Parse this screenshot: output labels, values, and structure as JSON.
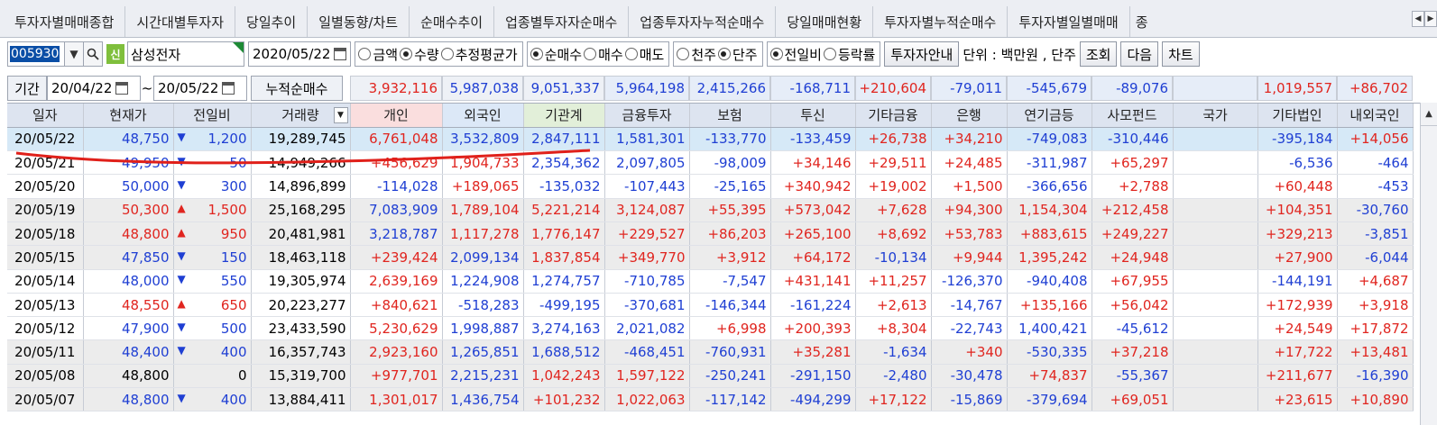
{
  "tabs": [
    "투자자별매매종합",
    "시간대별투자자",
    "당일추이",
    "일별동향/차트",
    "순매수추이",
    "업종별투자자순매수",
    "업종투자자누적순매수",
    "당일매매현황",
    "투자자별누적순매수",
    "투자자별일별매매",
    "종"
  ],
  "toolbar": {
    "code": "005930",
    "shin": "신",
    "stock_name": "삼성전자",
    "date": "2020/05/22",
    "radio1": [
      "금액",
      "수량",
      "추정평균가"
    ],
    "radio1_selected": "수량",
    "radio2": [
      "순매수",
      "매수",
      "매도"
    ],
    "radio2_selected": "순매수",
    "radio3": [
      "천주",
      "단주"
    ],
    "radio3_selected": "단주",
    "radio4": [
      "전일비",
      "등락률"
    ],
    "radio4_selected": "전일비",
    "investor_btn": "투자자안내",
    "unit": "단위 : 백만원 , 단주",
    "query_btn": "조회",
    "next_btn": "다음",
    "chart_btn": "차트"
  },
  "period": {
    "label": "기간",
    "from": "20/04/22",
    "tilde": "~",
    "to": "20/05/22",
    "cum_label": "누적순매수",
    "cum_values": [
      {
        "v": "3,932,116",
        "c": "red"
      },
      {
        "v": "5,987,038",
        "c": "blu"
      },
      {
        "v": "9,051,337",
        "c": "blu"
      },
      {
        "v": "5,964,198",
        "c": "blu"
      },
      {
        "v": "2,415,266",
        "c": "blu"
      },
      {
        "v": "-168,711",
        "c": "blu"
      },
      {
        "v": "+210,604",
        "c": "red"
      },
      {
        "v": "-79,011",
        "c": "blu"
      },
      {
        "v": "-545,679",
        "c": "blu"
      },
      {
        "v": "-89,076",
        "c": "blu"
      },
      {
        "v": "",
        "c": "blk"
      },
      {
        "v": "1,019,557",
        "c": "red"
      },
      {
        "v": "+86,702",
        "c": "red"
      }
    ]
  },
  "table": {
    "headers": [
      "일자",
      "현재가",
      "전일비",
      "거래량",
      "개인",
      "외국인",
      "기관계",
      "금융투자",
      "보험",
      "투신",
      "기타금융",
      "은행",
      "연기금등",
      "사모펀드",
      "국가",
      "기타법인",
      "내외국인"
    ],
    "rows": [
      {
        "date": "20/05/22",
        "price": "48,750",
        "pc": "blu",
        "dir": "down",
        "diff": "1,200",
        "vol": "19,289,745",
        "cells": [
          [
            "6,761,048",
            "red"
          ],
          [
            "3,532,809",
            "blu"
          ],
          [
            "2,847,111",
            "blu"
          ],
          [
            "1,581,301",
            "blu"
          ],
          [
            "-133,770",
            "blu"
          ],
          [
            "-133,459",
            "blu"
          ],
          [
            "+26,738",
            "red"
          ],
          [
            "+34,210",
            "red"
          ],
          [
            "-749,083",
            "blu"
          ],
          [
            "-310,446",
            "blu"
          ],
          [
            "",
            ""
          ],
          [
            "-395,184",
            "blu"
          ],
          [
            "+14,056",
            "red"
          ]
        ]
      },
      {
        "date": "20/05/21",
        "price": "49,950",
        "pc": "blu",
        "dir": "down",
        "diff": "50",
        "vol": "14,949,266",
        "cells": [
          [
            "+456,629",
            "red"
          ],
          [
            "1,904,733",
            "red"
          ],
          [
            "2,354,362",
            "blu"
          ],
          [
            "2,097,805",
            "blu"
          ],
          [
            "-98,009",
            "blu"
          ],
          [
            "+34,146",
            "red"
          ],
          [
            "+29,511",
            "red"
          ],
          [
            "+24,485",
            "red"
          ],
          [
            "-311,987",
            "blu"
          ],
          [
            "+65,297",
            "red"
          ],
          [
            "",
            ""
          ],
          [
            "-6,536",
            "blu"
          ],
          [
            "-464",
            "blu"
          ]
        ]
      },
      {
        "date": "20/05/20",
        "price": "50,000",
        "pc": "blu",
        "dir": "down",
        "diff": "300",
        "vol": "14,896,899",
        "cells": [
          [
            "-114,028",
            "blu"
          ],
          [
            "+189,065",
            "red"
          ],
          [
            "-135,032",
            "blu"
          ],
          [
            "-107,443",
            "blu"
          ],
          [
            "-25,165",
            "blu"
          ],
          [
            "+340,942",
            "red"
          ],
          [
            "+19,002",
            "red"
          ],
          [
            "+1,500",
            "red"
          ],
          [
            "-366,656",
            "blu"
          ],
          [
            "+2,788",
            "red"
          ],
          [
            "",
            ""
          ],
          [
            "+60,448",
            "red"
          ],
          [
            "-453",
            "blu"
          ]
        ]
      },
      {
        "date": "20/05/19",
        "price": "50,300",
        "pc": "red",
        "dir": "up",
        "diff": "1,500",
        "vol": "25,168,295",
        "cells": [
          [
            "7,083,909",
            "blu"
          ],
          [
            "1,789,104",
            "red"
          ],
          [
            "5,221,214",
            "red"
          ],
          [
            "3,124,087",
            "red"
          ],
          [
            "+55,395",
            "red"
          ],
          [
            "+573,042",
            "red"
          ],
          [
            "+7,628",
            "red"
          ],
          [
            "+94,300",
            "red"
          ],
          [
            "1,154,304",
            "red"
          ],
          [
            "+212,458",
            "red"
          ],
          [
            "",
            ""
          ],
          [
            "+104,351",
            "red"
          ],
          [
            "-30,760",
            "blu"
          ]
        ]
      },
      {
        "date": "20/05/18",
        "price": "48,800",
        "pc": "red",
        "dir": "up",
        "diff": "950",
        "vol": "20,481,981",
        "cells": [
          [
            "3,218,787",
            "blu"
          ],
          [
            "1,117,278",
            "red"
          ],
          [
            "1,776,147",
            "red"
          ],
          [
            "+229,527",
            "red"
          ],
          [
            "+86,203",
            "red"
          ],
          [
            "+265,100",
            "red"
          ],
          [
            "+8,692",
            "red"
          ],
          [
            "+53,783",
            "red"
          ],
          [
            "+883,615",
            "red"
          ],
          [
            "+249,227",
            "red"
          ],
          [
            "",
            ""
          ],
          [
            "+329,213",
            "red"
          ],
          [
            "-3,851",
            "blu"
          ]
        ]
      },
      {
        "date": "20/05/15",
        "price": "47,850",
        "pc": "blu",
        "dir": "down",
        "diff": "150",
        "vol": "18,463,118",
        "cells": [
          [
            "+239,424",
            "red"
          ],
          [
            "2,099,134",
            "blu"
          ],
          [
            "1,837,854",
            "red"
          ],
          [
            "+349,770",
            "red"
          ],
          [
            "+3,912",
            "red"
          ],
          [
            "+64,172",
            "red"
          ],
          [
            "-10,134",
            "blu"
          ],
          [
            "+9,944",
            "red"
          ],
          [
            "1,395,242",
            "red"
          ],
          [
            "+24,948",
            "red"
          ],
          [
            "",
            ""
          ],
          [
            "+27,900",
            "red"
          ],
          [
            "-6,044",
            "blu"
          ]
        ]
      },
      {
        "date": "20/05/14",
        "price": "48,000",
        "pc": "blu",
        "dir": "down",
        "diff": "550",
        "vol": "19,305,974",
        "cells": [
          [
            "2,639,169",
            "red"
          ],
          [
            "1,224,908",
            "blu"
          ],
          [
            "1,274,757",
            "blu"
          ],
          [
            "-710,785",
            "blu"
          ],
          [
            "-7,547",
            "blu"
          ],
          [
            "+431,141",
            "red"
          ],
          [
            "+11,257",
            "red"
          ],
          [
            "-126,370",
            "blu"
          ],
          [
            "-940,408",
            "blu"
          ],
          [
            "+67,955",
            "red"
          ],
          [
            "",
            ""
          ],
          [
            "-144,191",
            "blu"
          ],
          [
            "+4,687",
            "red"
          ]
        ]
      },
      {
        "date": "20/05/13",
        "price": "48,550",
        "pc": "red",
        "dir": "up",
        "diff": "650",
        "vol": "20,223,277",
        "cells": [
          [
            "+840,621",
            "red"
          ],
          [
            "-518,283",
            "blu"
          ],
          [
            "-499,195",
            "blu"
          ],
          [
            "-370,681",
            "blu"
          ],
          [
            "-146,344",
            "blu"
          ],
          [
            "-161,224",
            "blu"
          ],
          [
            "+2,613",
            "red"
          ],
          [
            "-14,767",
            "blu"
          ],
          [
            "+135,166",
            "red"
          ],
          [
            "+56,042",
            "red"
          ],
          [
            "",
            ""
          ],
          [
            "+172,939",
            "red"
          ],
          [
            "+3,918",
            "red"
          ]
        ]
      },
      {
        "date": "20/05/12",
        "price": "47,900",
        "pc": "blu",
        "dir": "down",
        "diff": "500",
        "vol": "23,433,590",
        "cells": [
          [
            "5,230,629",
            "red"
          ],
          [
            "1,998,887",
            "blu"
          ],
          [
            "3,274,163",
            "blu"
          ],
          [
            "2,021,082",
            "blu"
          ],
          [
            "+6,998",
            "red"
          ],
          [
            "+200,393",
            "red"
          ],
          [
            "+8,304",
            "red"
          ],
          [
            "-22,743",
            "blu"
          ],
          [
            "1,400,421",
            "blu"
          ],
          [
            "-45,612",
            "blu"
          ],
          [
            "",
            ""
          ],
          [
            "+24,549",
            "red"
          ],
          [
            "+17,872",
            "red"
          ]
        ]
      },
      {
        "date": "20/05/11",
        "price": "48,400",
        "pc": "blu",
        "dir": "down",
        "diff": "400",
        "vol": "16,357,743",
        "cells": [
          [
            "2,923,160",
            "red"
          ],
          [
            "1,265,851",
            "blu"
          ],
          [
            "1,688,512",
            "blu"
          ],
          [
            "-468,451",
            "blu"
          ],
          [
            "-760,931",
            "blu"
          ],
          [
            "+35,281",
            "red"
          ],
          [
            "-1,634",
            "blu"
          ],
          [
            "+340",
            "red"
          ],
          [
            "-530,335",
            "blu"
          ],
          [
            "+37,218",
            "red"
          ],
          [
            "",
            ""
          ],
          [
            "+17,722",
            "red"
          ],
          [
            "+13,481",
            "red"
          ]
        ]
      },
      {
        "date": "20/05/08",
        "price": "48,800",
        "pc": "blk",
        "dir": "none",
        "diff": "0",
        "vol": "15,319,700",
        "cells": [
          [
            "+977,701",
            "red"
          ],
          [
            "2,215,231",
            "blu"
          ],
          [
            "1,042,243",
            "red"
          ],
          [
            "1,597,122",
            "red"
          ],
          [
            "-250,241",
            "blu"
          ],
          [
            "-291,150",
            "blu"
          ],
          [
            "-2,480",
            "blu"
          ],
          [
            "-30,478",
            "blu"
          ],
          [
            "+74,837",
            "red"
          ],
          [
            "-55,367",
            "blu"
          ],
          [
            "",
            ""
          ],
          [
            "+211,677",
            "red"
          ],
          [
            "-16,390",
            "blu"
          ]
        ]
      },
      {
        "date": "20/05/07",
        "price": "48,800",
        "pc": "blu",
        "dir": "down",
        "diff": "400",
        "vol": "13,884,411",
        "cells": [
          [
            "1,301,017",
            "red"
          ],
          [
            "1,436,754",
            "blu"
          ],
          [
            "+101,232",
            "red"
          ],
          [
            "1,022,063",
            "red"
          ],
          [
            "-117,142",
            "blu"
          ],
          [
            "-494,299",
            "blu"
          ],
          [
            "+17,122",
            "red"
          ],
          [
            "-15,869",
            "blu"
          ],
          [
            "-379,694",
            "blu"
          ],
          [
            "+69,051",
            "red"
          ],
          [
            "",
            ""
          ],
          [
            "+23,615",
            "red"
          ],
          [
            "+10,890",
            "red"
          ]
        ]
      }
    ]
  },
  "icons": {
    "dropdown": "chevron-down-icon",
    "search": "search-icon",
    "calendar": "calendar-icon",
    "down": "triangle-down-icon",
    "up": "triangle-up-icon"
  },
  "colors": {
    "up": "#e0251f",
    "down": "#1f3fd3",
    "selected_row": "#d6e9f7",
    "annotation": "#e0201a"
  }
}
